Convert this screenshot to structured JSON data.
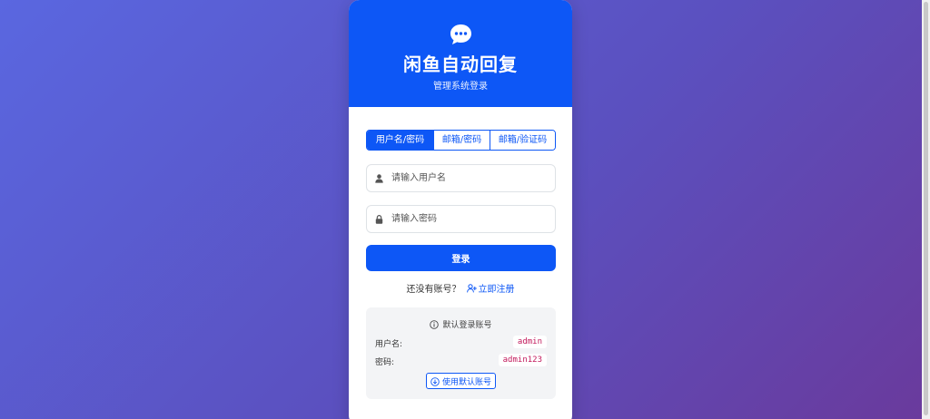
{
  "header": {
    "logo_icon": "chat-bubble-icon",
    "title": "闲鱼自动回复",
    "subtitle": "管理系统登录"
  },
  "tabs": [
    {
      "label": "用户名/密码",
      "active": true
    },
    {
      "label": "邮箱/密码",
      "active": false
    },
    {
      "label": "邮箱/验证码",
      "active": false
    }
  ],
  "form": {
    "username_placeholder": "请输入用户名",
    "username_icon": "user-icon",
    "password_placeholder": "请输入密码",
    "password_icon": "lock-icon",
    "login_label": "登录"
  },
  "register": {
    "prompt": "还没有账号？",
    "link_label": "立即注册",
    "link_icon": "user-plus-icon"
  },
  "default_account": {
    "title": "默认登录账号",
    "title_icon": "info-circle-icon",
    "username_label": "用户名:",
    "username_value": "admin",
    "password_label": "密码:",
    "password_value": "admin123",
    "use_button_label": "使用默认账号",
    "use_button_icon": "download-circle-icon"
  },
  "colors": {
    "primary": "#0d57f6",
    "background_start": "#5a67e0",
    "background_end": "#6a3a9c",
    "code_text": "#c2185b"
  }
}
